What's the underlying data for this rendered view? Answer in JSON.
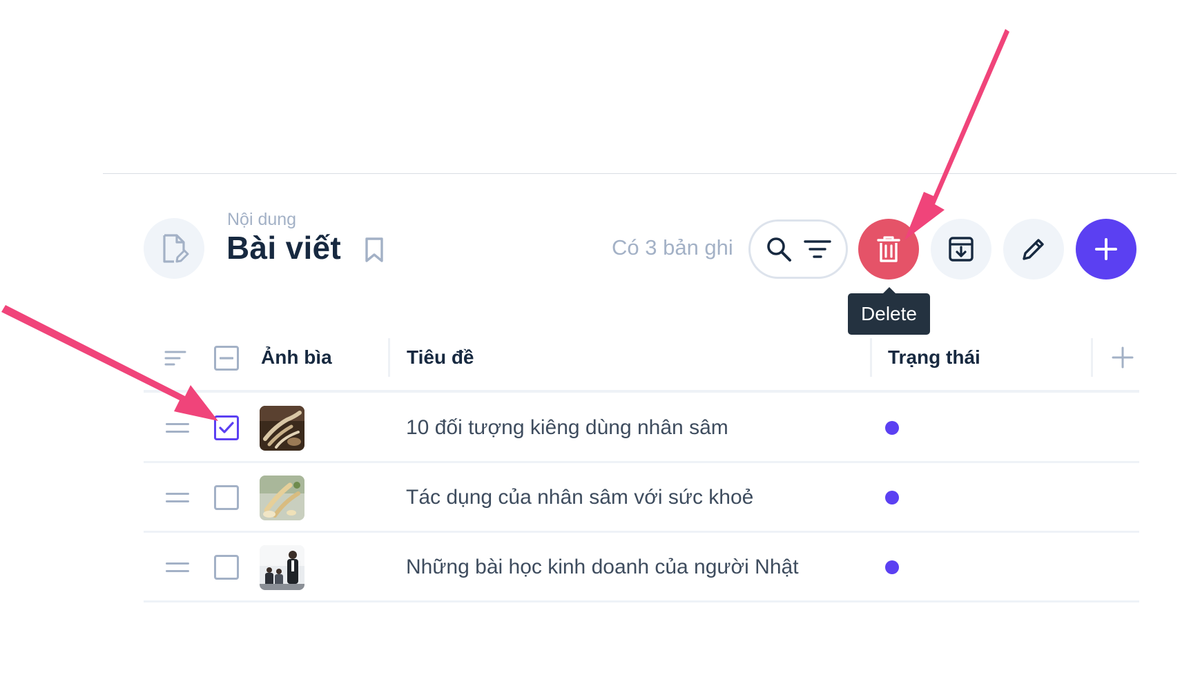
{
  "header": {
    "breadcrumb": "Nội dung",
    "title": "Bài viết",
    "record_count": "Có 3 bản ghi"
  },
  "toolbar": {
    "delete_tooltip": "Delete",
    "icons": [
      "search-icon",
      "filter-icon",
      "trash-icon",
      "archive-download-icon",
      "pencil-icon",
      "plus-icon"
    ]
  },
  "table": {
    "columns": [
      "Ảnh bìa",
      "Tiêu đề",
      "Trạng thái"
    ],
    "rows": [
      {
        "title": "10 đối tượng kiêng dùng nhân sâm",
        "checked": true
      },
      {
        "title": "Tác dụng của nhân sâm với sức khoẻ",
        "checked": false
      },
      {
        "title": "Những bài học kinh doanh của người Nhật",
        "checked": false
      }
    ]
  },
  "colors": {
    "primary": "#5b40f2",
    "danger": "#e55368",
    "muted": "#a3b1c6",
    "text": "#172940",
    "annotation_arrow": "#f0447a"
  }
}
